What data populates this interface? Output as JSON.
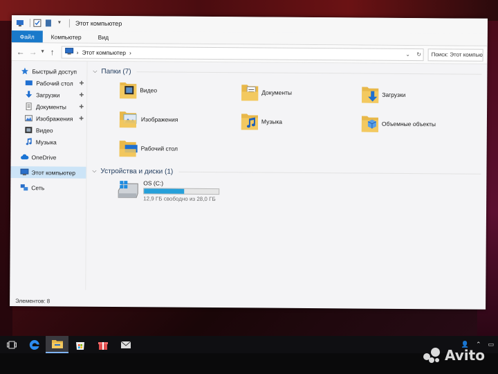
{
  "window": {
    "title": "Этот компьютер",
    "ribbon_tabs": [
      "Файл",
      "Компьютер",
      "Вид"
    ]
  },
  "address": {
    "path_label": "Этот компьютер",
    "search_placeholder": "Поиск: Этот компьют..."
  },
  "sidebar": {
    "quick_access": "Быстрый доступ",
    "quick_items": [
      {
        "label": "Рабочий стол",
        "pinned": true
      },
      {
        "label": "Загрузки",
        "pinned": true
      },
      {
        "label": "Документы",
        "pinned": true
      },
      {
        "label": "Изображения",
        "pinned": true
      },
      {
        "label": "Видео",
        "pinned": false
      },
      {
        "label": "Музыка",
        "pinned": false
      }
    ],
    "onedrive": "OneDrive",
    "this_pc": "Этот компьютер",
    "network": "Сеть",
    "pin_glyph": "📌"
  },
  "folders_section": {
    "header": "Папки (7)",
    "items": [
      "Видео",
      "Документы",
      "Загрузки",
      "Изображения",
      "Музыка",
      "Объемные объекты",
      "Рабочий стол"
    ]
  },
  "drives_section": {
    "header": "Устройства и диски (1)",
    "drive": {
      "name": "OS (C:)",
      "free_text": "12,9 ГБ свободно из 28,0 ГБ",
      "used_fraction": 0.54
    }
  },
  "status": {
    "items_count": "Элементов: 8"
  },
  "watermark": {
    "text": "Avito"
  },
  "colors": {
    "accent": "#1979ca",
    "folder": "#e8b84a",
    "drive_bar": "#26a0da"
  }
}
